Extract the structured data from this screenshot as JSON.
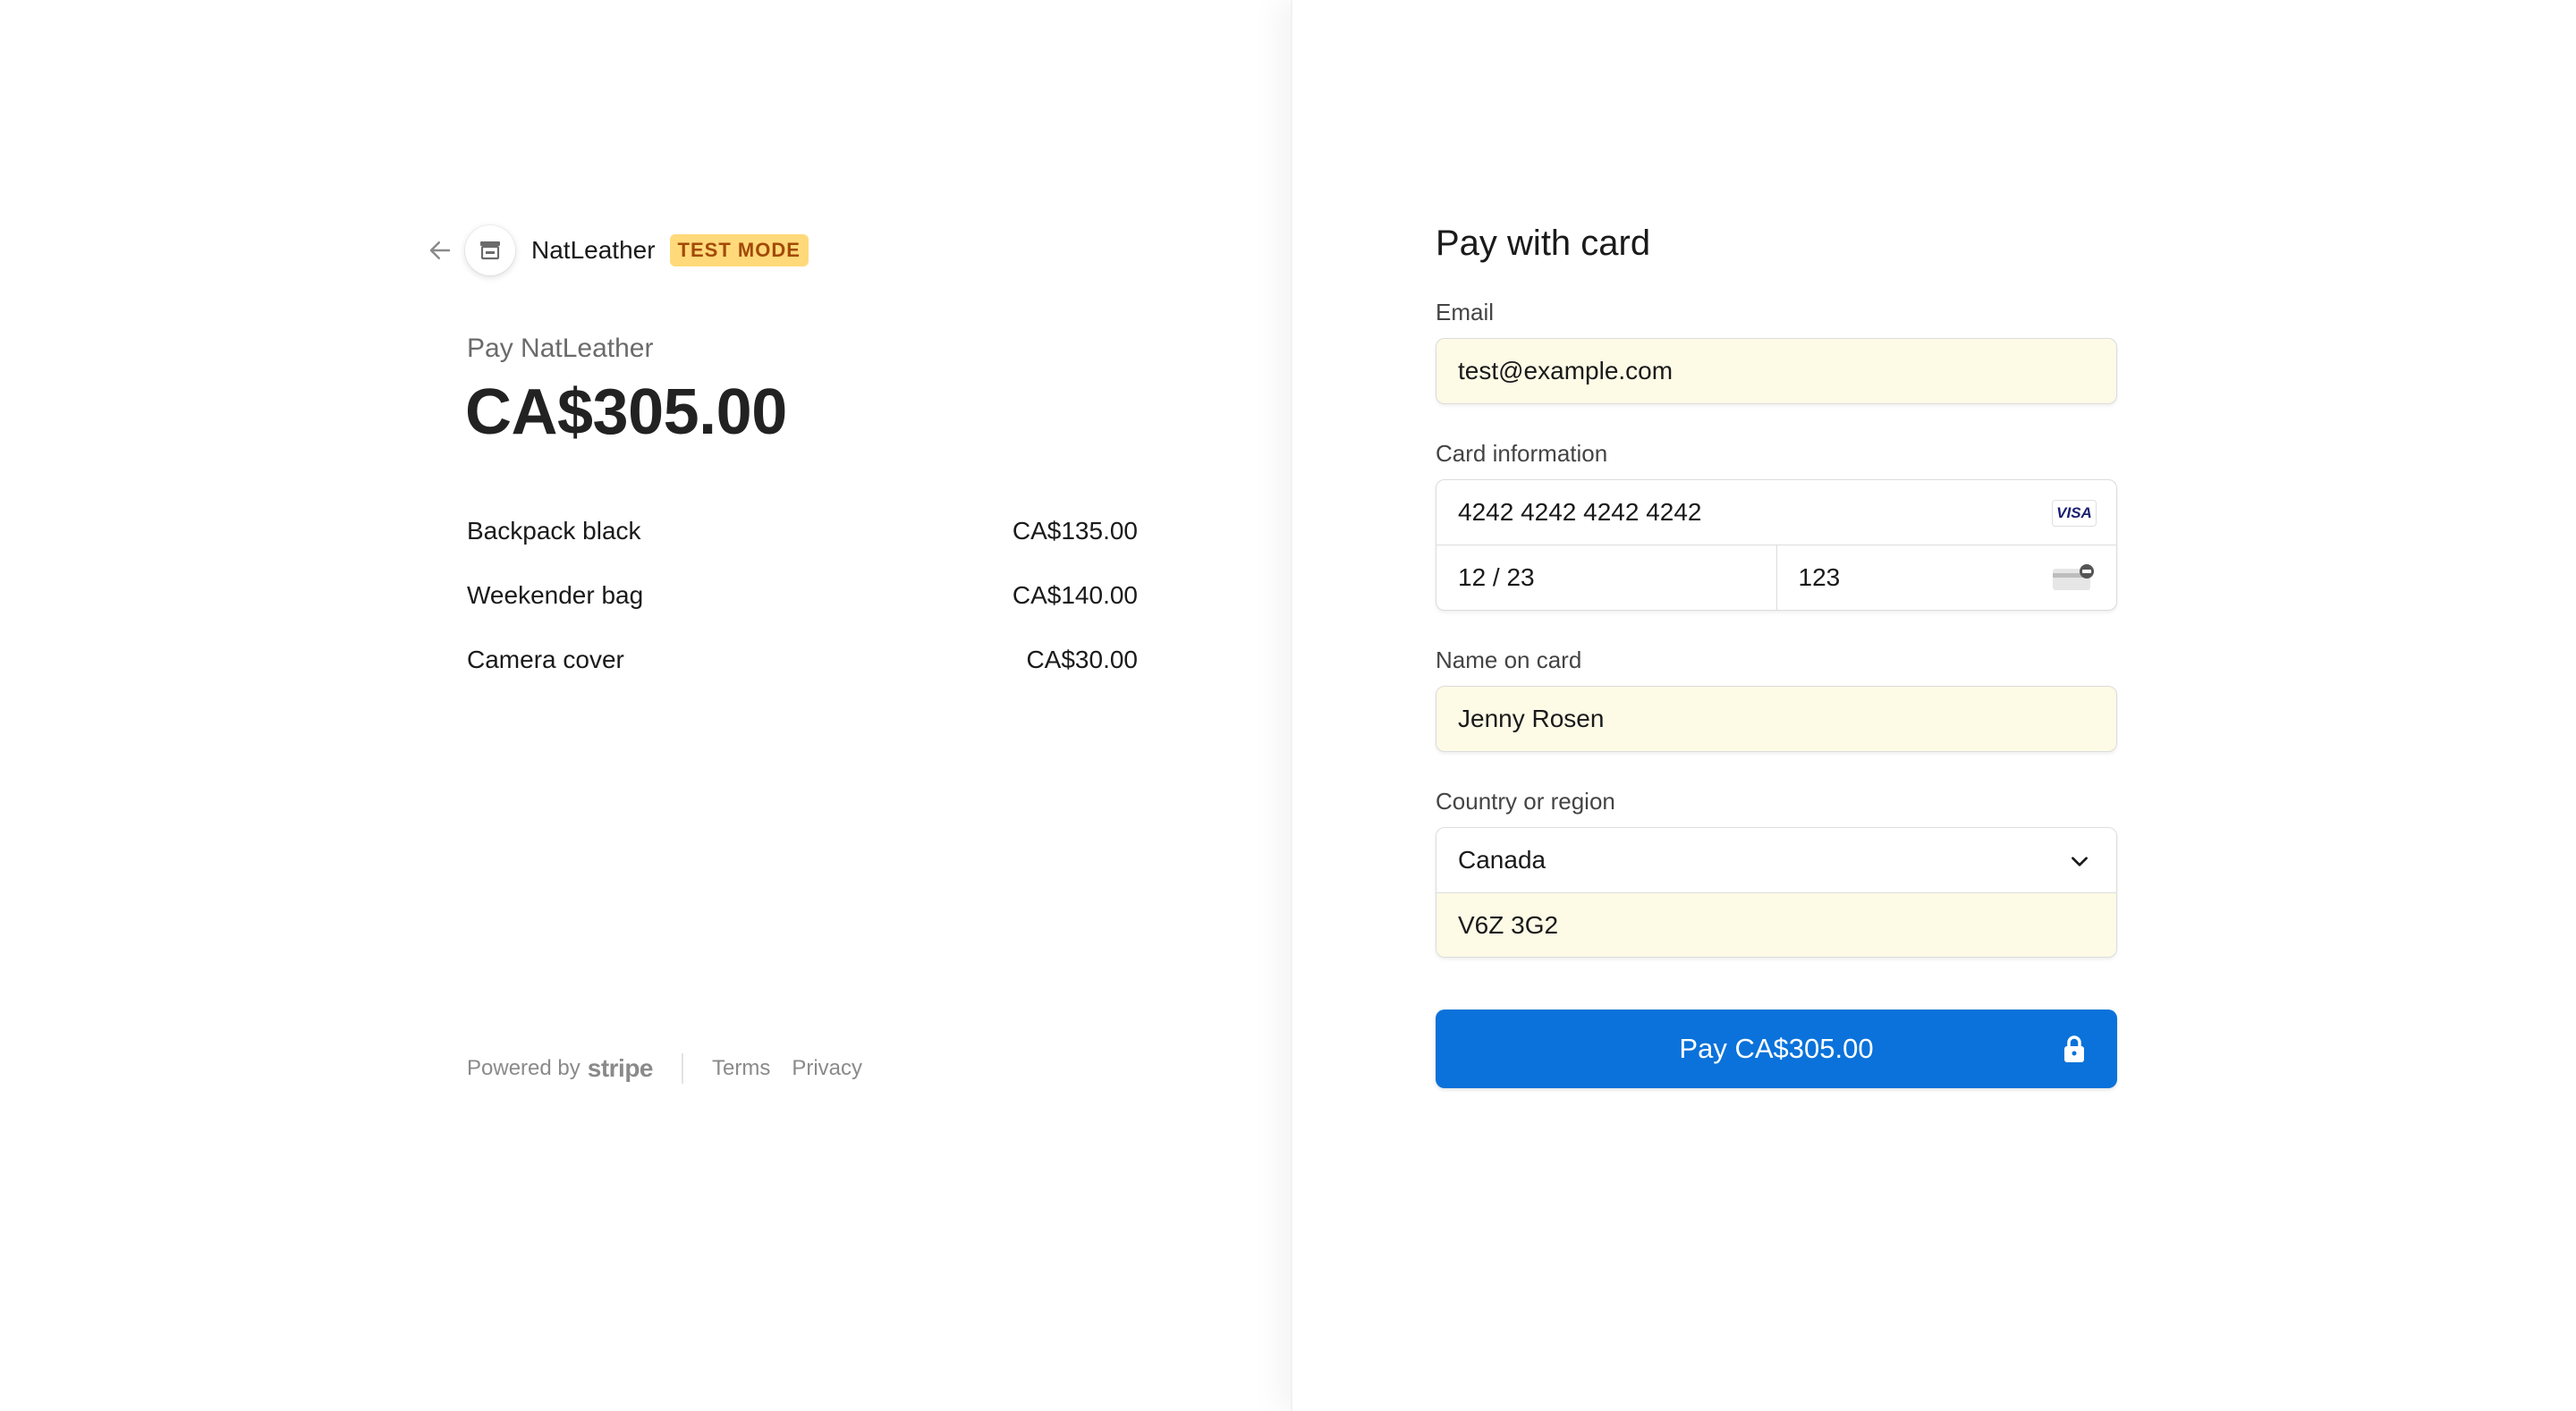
{
  "merchant": {
    "name": "NatLeather",
    "badge": "TEST MODE"
  },
  "summary": {
    "pay_to": "Pay NatLeather",
    "total": "CA$305.00",
    "items": [
      {
        "name": "Backpack black",
        "price": "CA$135.00"
      },
      {
        "name": "Weekender bag",
        "price": "CA$140.00"
      },
      {
        "name": "Camera cover",
        "price": "CA$30.00"
      }
    ]
  },
  "footer": {
    "powered_by": "Powered by",
    "brand": "stripe",
    "terms": "Terms",
    "privacy": "Privacy"
  },
  "form": {
    "title": "Pay with card",
    "email": {
      "label": "Email",
      "value": "test@example.com"
    },
    "card": {
      "label": "Card information",
      "number": "4242 4242 4242 4242",
      "expiry": "12 / 23",
      "cvc": "123",
      "brand": "VISA"
    },
    "name": {
      "label": "Name on card",
      "value": "Jenny Rosen"
    },
    "country": {
      "label": "Country or region",
      "value": "Canada",
      "postal": "V6Z 3G2"
    },
    "pay_button": "Pay CA$305.00"
  },
  "colors": {
    "accent": "#0a72da",
    "badge_bg": "#ffd97a",
    "badge_text": "#a24a05",
    "autofill_bg": "#fdfae6"
  },
  "icons": [
    "back-arrow-icon",
    "store-icon",
    "visa-icon",
    "cvc-card-icon",
    "chevron-down-icon",
    "lock-icon"
  ]
}
